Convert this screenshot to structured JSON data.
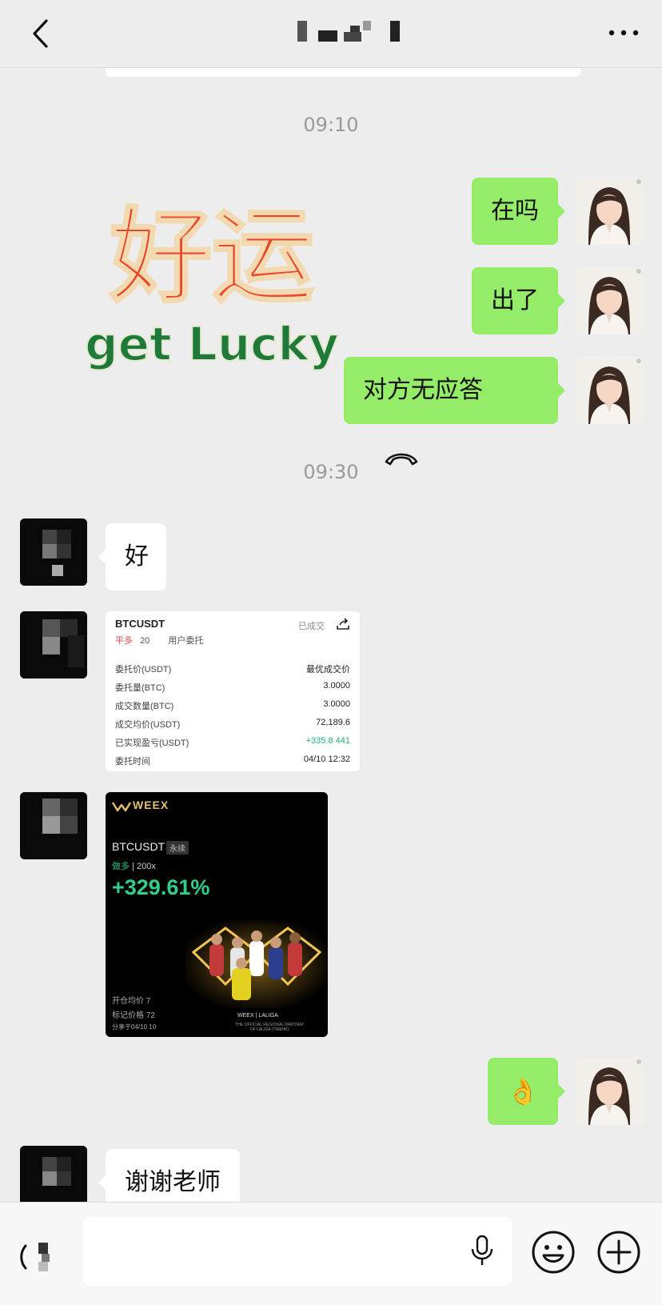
{
  "header": {
    "back_icon": "chevron-left-icon",
    "title_masked": true,
    "more_icon": "more-horizontal-icon"
  },
  "timestamps": [
    "09:10",
    "09:30"
  ],
  "sticker": {
    "chinese": "好运",
    "english": "get Lucky",
    "colors": {
      "chinese": "#e8472a",
      "english": "#1f7a3a"
    }
  },
  "messages_me_1": [
    "在吗",
    "出了"
  ],
  "call_message": {
    "label": "对方无应答",
    "icon": "phone-hangup-icon"
  },
  "reply_good": "好",
  "trade_card": {
    "symbol": "BTCUSDT",
    "status": "已成交",
    "direction": "平多",
    "date_prefix": "20",
    "source": "用户委托",
    "rows": [
      {
        "label": "委托价(USDT)",
        "value": "最优成交价",
        "color": "normal"
      },
      {
        "label": "委托量(BTC)",
        "value": "3.0000",
        "color": "normal"
      },
      {
        "label": "成交数量(BTC)",
        "value": "3.0000",
        "color": "normal"
      },
      {
        "label": "成交均价(USDT)",
        "value": "72,189.6",
        "color": "normal"
      },
      {
        "label": "已实现盈亏(USDT)",
        "value": "+335.8 441",
        "color": "green"
      },
      {
        "label": "委托时间",
        "value": "04/10 12:32",
        "color": "normal"
      }
    ]
  },
  "share_card": {
    "brand": "WEEX",
    "symbol": "BTCUSDT",
    "tag": "永续",
    "direction": "做多",
    "leverage": "200x",
    "pnl_percent": "+329.61%",
    "open_price_label": "开仓均价 7",
    "mark_price_label": "标记价格 72",
    "share_time_label": "分享于04/10 10",
    "partner_brand": "WEEX | LALIGA",
    "partner_text": "THE OFFICIAL REGIONAL PARTNER OF LALIGA (TW&HK)",
    "colors": {
      "gold": "#e6c066",
      "green": "#2fd08b"
    }
  },
  "ok_emoji": "👌",
  "reply_thanks": "谢谢老师",
  "footer": {
    "voice_icon": "voice-toggle-icon",
    "input_value": "",
    "mic_icon": "microphone-icon",
    "emoji_icon": "smile-icon",
    "add_icon": "plus-circle-icon"
  },
  "colors": {
    "background": "#ededed",
    "my_bubble": "#95ec69",
    "other_bubble": "#ffffff",
    "timestamp": "#9a9a9a"
  }
}
